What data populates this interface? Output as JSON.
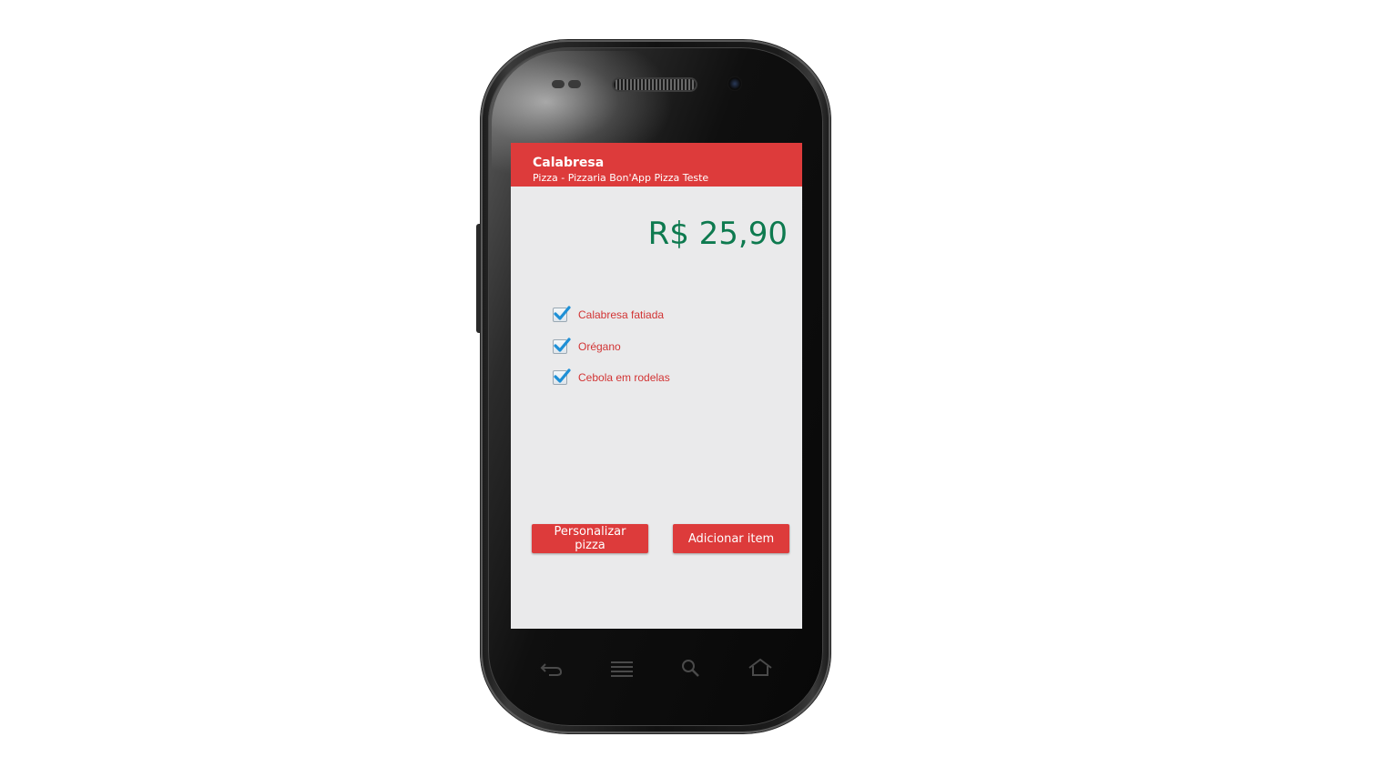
{
  "app": {
    "title": "Calabresa",
    "subtitle": "Pizza - Pizzaria Bon'App Pizza Teste"
  },
  "price": "R$ 25,90",
  "ingredients": [
    {
      "label": "Calabresa fatiada",
      "checked": true
    },
    {
      "label": "Orégano",
      "checked": true
    },
    {
      "label": "Cebola em rodelas",
      "checked": true
    }
  ],
  "buttons": {
    "customize": "Personalizar pizza",
    "add": "Adicionar item"
  },
  "navbar": {
    "icons": [
      "back-icon",
      "menu-icon",
      "search-icon",
      "home-icon"
    ]
  },
  "colors": {
    "accent": "#dd3b3b",
    "price": "#0e7a4f",
    "screen_bg": "#eaeaeb",
    "ingredient_text": "#d23434"
  }
}
